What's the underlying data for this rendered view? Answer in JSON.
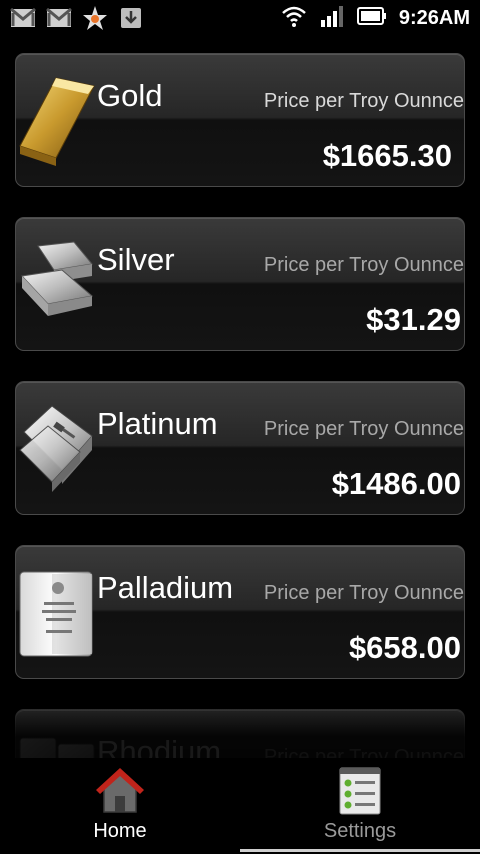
{
  "status_bar": {
    "time": "9:26AM",
    "left_icons": [
      "gmail-icon",
      "gmail-icon",
      "star-notification-icon",
      "download-icon"
    ],
    "right_icons": [
      "wifi-icon",
      "signal-icon",
      "battery-icon"
    ]
  },
  "metals": [
    {
      "name": "Gold",
      "subtitle": "Price per Troy Ounnce",
      "price": "$1665.30",
      "icon": "gold-bar-icon"
    },
    {
      "name": "Silver",
      "subtitle": "Price per Troy Ounnce",
      "price": "$31.29",
      "icon": "silver-bars-icon"
    },
    {
      "name": "Platinum",
      "subtitle": "Price per Troy Ounnce",
      "price": "$1486.00",
      "icon": "platinum-bars-icon"
    },
    {
      "name": "Palladium",
      "subtitle": "Price per Troy Ounnce",
      "price": "$658.00",
      "icon": "palladium-bar-icon"
    },
    {
      "name": "Rhodium",
      "subtitle": "Price per Troy Ounnce",
      "price": "",
      "icon": "rhodium-bars-icon"
    }
  ],
  "tabs": [
    {
      "label": "Home",
      "icon": "home-icon",
      "selected": true
    },
    {
      "label": "Settings",
      "icon": "settings-list-icon",
      "selected": false
    }
  ],
  "colors": {
    "background": "#000000",
    "gold": "#c99a2e",
    "tab_active_label": "#ffffff",
    "tab_inactive_label": "#9a9a9a",
    "home_roof": "#c0241b"
  }
}
